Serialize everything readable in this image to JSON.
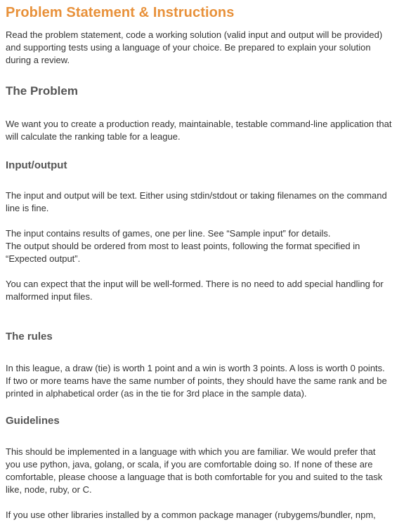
{
  "title": "Problem Statement & Instructions",
  "intro": [
    "Read the problem statement, code a working solution (valid input and output will be provided)",
    "and supporting tests using a language of your choice. Be prepared to explain your solution",
    "during a review."
  ],
  "problem": {
    "heading": "The Problem",
    "lines": [
      "We want you to create a production ready, maintainable, testable command-line application that",
      "will calculate the ranking table for a league."
    ]
  },
  "io": {
    "heading": "Input/output",
    "p1": [
      "The input and output will be text. Either using stdin/stdout or taking filenames on the command",
      "line is fine."
    ],
    "p2": [
      "The input contains results of games, one per line. See “Sample input” for details.",
      "The output should be ordered from most to least points, following the format specified in",
      "“Expected output”."
    ],
    "p3": [
      "You can expect that the input will be well-formed. There is no need to add special handling for",
      "malformed input files."
    ]
  },
  "rules": {
    "heading": "The rules",
    "lines": [
      "In this league, a draw (tie) is worth 1 point and a win is worth 3 points. A loss is worth 0 points.",
      "If two or more teams have the same number of points, they should have the same rank and be",
      "printed in alphabetical order (as in the tie for 3rd place in the sample data)."
    ]
  },
  "guidelines": {
    "heading": "Guidelines",
    "p1": [
      "This should be implemented in a language with which you are familiar.  We would prefer that",
      "you use python, java, golang, or scala, if you are comfortable doing so.  If none of these are",
      "comfortable, please choose a language that is both comfortable for you and suited to the task",
      "like, node, ruby, or C."
    ],
    "p2": [
      "If you use other libraries installed by a common package manager (rubygems/bundler, npm,"
    ]
  }
}
